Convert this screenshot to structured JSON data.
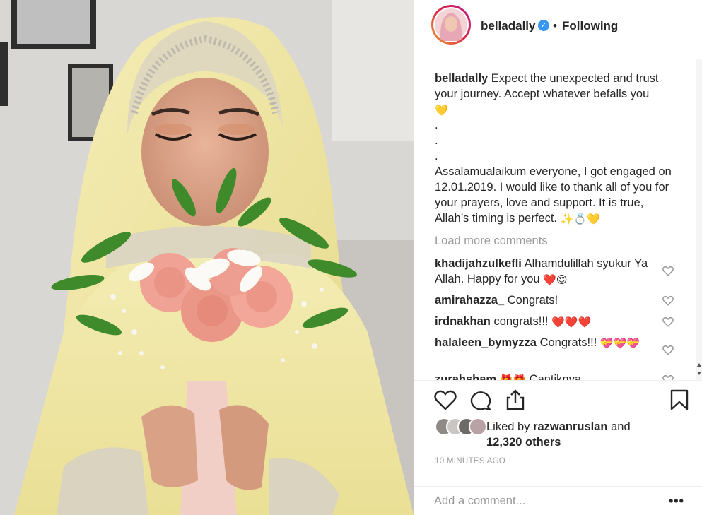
{
  "header": {
    "username": "belladally",
    "separator": "•",
    "follow_state": "Following",
    "verified_mark": "✓"
  },
  "caption": {
    "username": "belladally",
    "line1": "Expect the unexpected and trust your journey. Accept whatever befalls you",
    "emoji1": "💛",
    "dots": [
      ".",
      ".",
      "."
    ],
    "body": "Assalamualaikum everyone, I got engaged on 12.01.2019. I would like to thank all of you for your prayers, love and support. It is true, Allah’s timing is perfect.",
    "emoji2": "✨💍💛"
  },
  "load_more": "Load more comments",
  "comments": [
    {
      "username": "khadijahzulkefli",
      "text": "Alhamdulillah syukur Ya Allah. Happy for you",
      "emoji": "❤️😍"
    },
    {
      "username": "amirahazza_",
      "text": "Congrats!",
      "emoji": ""
    },
    {
      "username": "irdnakhan",
      "text": "congrats!!!",
      "emoji": "❤️❤️❤️"
    },
    {
      "username": "halaleen_bymyzza",
      "text": "Congrats!!!",
      "emoji": "💝💝💝"
    },
    {
      "username": "zurahsham",
      "text": "Cantiknya",
      "emoji": "🎁🎁"
    }
  ],
  "likes": {
    "prefix": "Liked by",
    "user": "razwanruslan",
    "and": "and",
    "others": "12,320 others"
  },
  "timestamp": "10 MINUTES AGO",
  "add_comment": {
    "placeholder": "Add a comment..."
  },
  "more_icon": "•••",
  "icons": {
    "like": "heart-outline-icon",
    "comment": "comment-bubble-icon",
    "share": "share-icon",
    "save": "bookmark-icon",
    "comment_like": "small-heart-icon",
    "more": "ellipsis-icon"
  },
  "colors": {
    "text": "#262626",
    "muted": "#999999",
    "verified": "#3897f0",
    "border": "#efefef"
  }
}
